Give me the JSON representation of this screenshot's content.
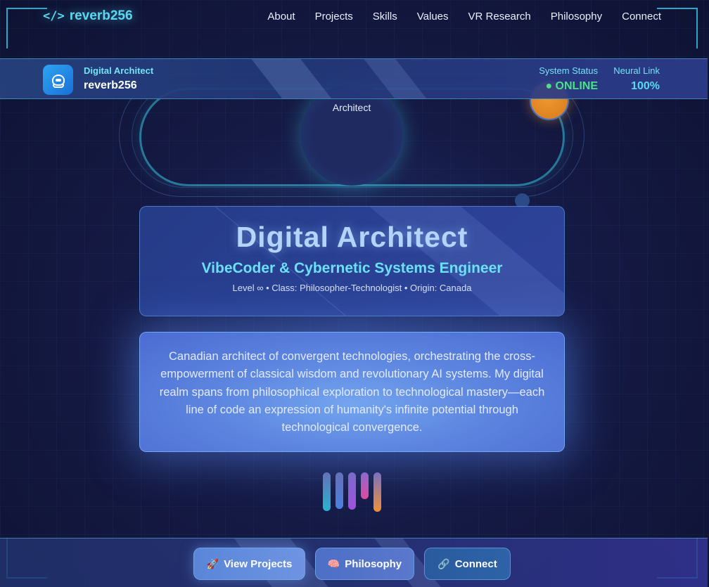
{
  "nav": {
    "logo_icon": "</>",
    "logo_text": "reverb256",
    "links": [
      "About",
      "Projects",
      "Skills",
      "Values",
      "VR Research",
      "Philosophy",
      "Connect"
    ]
  },
  "status_bar": {
    "avatar_icon": "robot-icon",
    "title": "Digital Architect",
    "name": "reverb256",
    "system_status_label": "System Status",
    "system_status_value": "● ONLINE",
    "neural_link_label": "Neural Link",
    "neural_link_value": "100%"
  },
  "orbit": {
    "core_label": "Architect"
  },
  "hero": {
    "title": "Digital Architect",
    "subtitle": "VibeCoder & Cybernetic Systems Engineer",
    "meta": "Level ∞ • Class: Philosopher-Technologist • Origin: Canada"
  },
  "description": "Canadian architect of convergent technologies, orchestrating the cross-empowerment of classical wisdom and revolutionary AI systems. My digital realm spans from philosophical exploration to technological mastery—each line of code an expression of humanity's infinite potential through technological convergence.",
  "actions": {
    "projects_label": "View Projects",
    "projects_icon": "rocket-icon",
    "philosophy_label": "Philosophy",
    "philosophy_icon": "brain-icon",
    "connect_label": "Connect",
    "connect_icon": "link-icon"
  },
  "colors": {
    "accent_cyan": "#5ad8f0",
    "online_green": "#4de08a",
    "orange_orb": "#e08a28",
    "background": "#151a45"
  }
}
